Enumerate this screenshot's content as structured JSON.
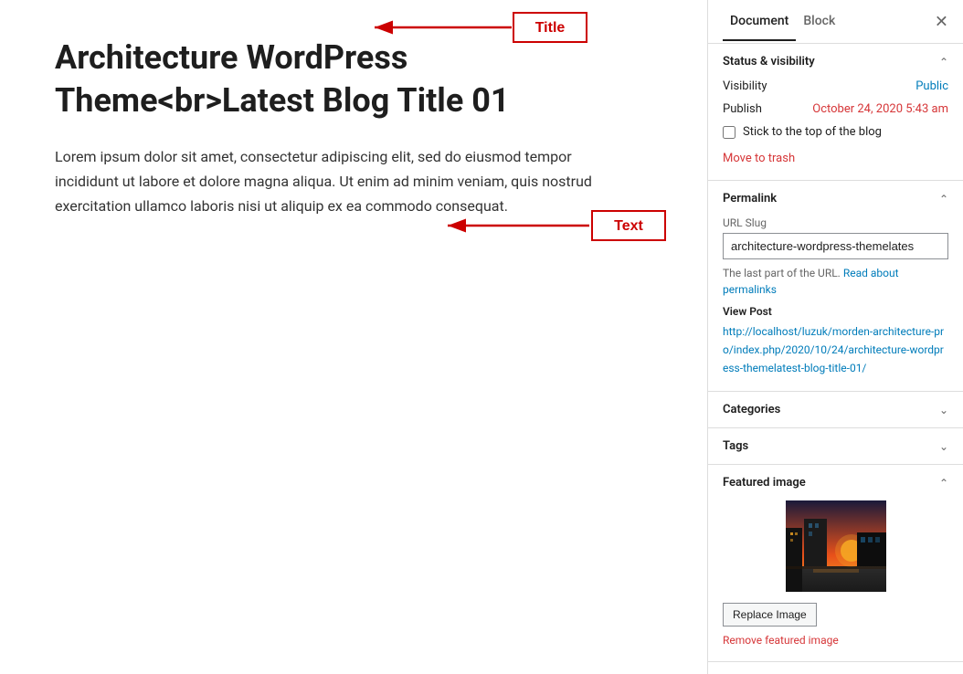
{
  "tabs": {
    "document_label": "Document",
    "block_label": "Block"
  },
  "post": {
    "title": "Architecture WordPress Theme<br>Latest Blog Title 01",
    "title_plain": "Architecture WordPress Theme<br>Latest Blog Title 01",
    "content": "Lorem ipsum dolor sit amet, consectetur adipiscing elit, sed do eiusmod tempor incididunt ut labore et dolore magna aliqua. Ut enim ad minim veniam, quis nostrud exercitation ullamco laboris nisi ut aliquip ex ea commodo consequat."
  },
  "annotations": {
    "title_label": "Title",
    "text_label": "Text"
  },
  "sidebar": {
    "status_visibility": {
      "section_title": "Status & visibility",
      "visibility_label": "Visibility",
      "visibility_value": "Public",
      "publish_label": "Publish",
      "publish_value": "October 24, 2020 5:43 am",
      "stick_label": "Stick to the top of the blog",
      "move_to_trash": "Move to trash"
    },
    "permalink": {
      "section_title": "Permalink",
      "url_slug_label": "URL Slug",
      "url_slug_value": "architecture-wordpress-themelates",
      "note": "The last part of the URL.",
      "read_about_label": "Read about permalinks",
      "view_post_label": "View Post",
      "view_post_url": "http://localhost/luzuk/morden-architecture-pro/index.php/2020/10/24/architecture-wordpress-themelatest-blog-title-01/"
    },
    "categories": {
      "section_title": "Categories"
    },
    "tags": {
      "section_title": "Tags"
    },
    "featured_image": {
      "section_title": "Featured image",
      "replace_button": "Replace Image",
      "remove_link": "Remove featured image"
    }
  }
}
